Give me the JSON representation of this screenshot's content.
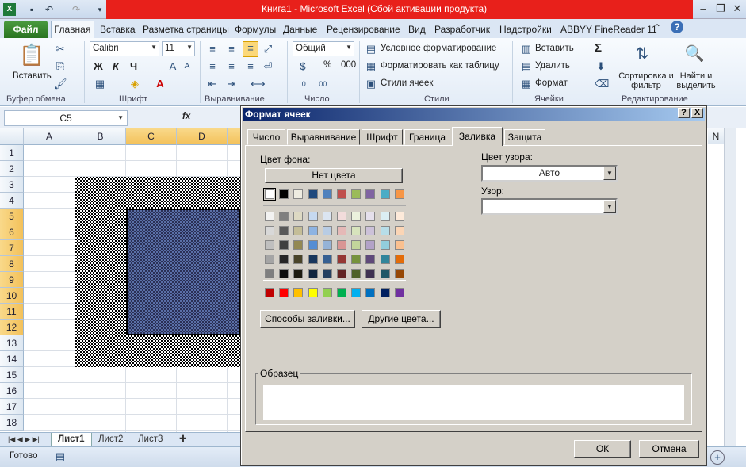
{
  "window": {
    "title": "Книга1  -  Microsoft Excel (Сбой активации продукта)"
  },
  "ribbon_tabs": {
    "file": "Файл",
    "items": [
      "Главная",
      "Вставка",
      "Разметка страницы",
      "Формулы",
      "Данные",
      "Рецензирование",
      "Вид",
      "Разработчик",
      "Надстройки",
      "ABBYY FineReader 11"
    ]
  },
  "ribbon": {
    "paste": "Вставить",
    "clipboard": "Буфер обмена",
    "font_name": "Calibri",
    "font_size": "11",
    "bold": "Ж",
    "italic": "К",
    "underline": "Ч",
    "font_group": "Шрифт",
    "align_group": "Выравнивание",
    "number_format": "Общий",
    "percent": "%",
    "thousands": "000",
    "number_group": "Число",
    "cond_format": "Условное форматирование",
    "format_table": "Форматировать как таблицу",
    "cell_styles": "Стили ячеек",
    "styles_group": "Стили",
    "insert": "Вставить",
    "delete": "Удалить",
    "format": "Формат",
    "cells_group": "Ячейки",
    "sigma": "Σ",
    "sort": "Сортировка и фильтр",
    "find": "Найти и выделить",
    "edit_group": "Редактирование"
  },
  "formula_bar": {
    "name_box": "C5",
    "fx": "fx"
  },
  "grid": {
    "columns": [
      "A",
      "B",
      "C",
      "D"
    ],
    "rows": [
      "1",
      "2",
      "3",
      "4",
      "5",
      "6",
      "7",
      "8",
      "9",
      "10",
      "11",
      "12",
      "13",
      "14",
      "15",
      "16",
      "17",
      "18"
    ],
    "right_col_partial": "N"
  },
  "sheets": [
    "Лист1",
    "Лист2",
    "Лист3"
  ],
  "status": "Готово",
  "dialog": {
    "title": "Формат ячеек",
    "help": "?",
    "close": "X",
    "tabs": [
      "Число",
      "Выравнивание",
      "Шрифт",
      "Граница",
      "Заливка",
      "Защита"
    ],
    "active_tab": "Заливка",
    "bg_color_label": "Цвет фона:",
    "no_color": "Нет цвета",
    "pattern_color_label": "Цвет узора:",
    "pattern_color_value": "Авто",
    "pattern_label": "Узор:",
    "pattern_value": "",
    "fill_effects": "Способы заливки...",
    "more_colors": "Другие цвета...",
    "sample_label": "Образец",
    "ok": "ОК",
    "cancel": "Отмена",
    "palette_row1": [
      "#ffffff",
      "#000000",
      "#eeece1",
      "#1f497d",
      "#4f81bd",
      "#c0504d",
      "#9bbb59",
      "#8064a2",
      "#4bacc6",
      "#f79646"
    ],
    "palette_tints": [
      [
        "#f2f2f2",
        "#7f7f7f",
        "#ddd9c3",
        "#c6d9f0",
        "#dbe5f1",
        "#f2dcdb",
        "#ebf1dd",
        "#e5e0ec",
        "#dbeef3",
        "#fdeada"
      ],
      [
        "#d8d8d8",
        "#595959",
        "#c4bd97",
        "#8db3e2",
        "#b8cce4",
        "#e5b9b7",
        "#d7e3bc",
        "#ccc1d9",
        "#b7dde8",
        "#fbd5b5"
      ],
      [
        "#bfbfbf",
        "#3f3f3f",
        "#938953",
        "#548dd4",
        "#95b3d7",
        "#d99694",
        "#c3d69b",
        "#b2a2c7",
        "#92cddc",
        "#fac08f"
      ],
      [
        "#a5a5a5",
        "#262626",
        "#494429",
        "#17365d",
        "#366092",
        "#953734",
        "#76923c",
        "#5f497a",
        "#31859b",
        "#e36c09"
      ],
      [
        "#7f7f7f",
        "#0c0c0c",
        "#1d1b10",
        "#0f243e",
        "#244061",
        "#632423",
        "#4f6128",
        "#3f3151",
        "#205867",
        "#974806"
      ]
    ],
    "palette_standard": [
      "#c00000",
      "#ff0000",
      "#ffc000",
      "#ffff00",
      "#92d050",
      "#00b050",
      "#00b0f0",
      "#0070c0",
      "#002060",
      "#7030a0"
    ]
  }
}
